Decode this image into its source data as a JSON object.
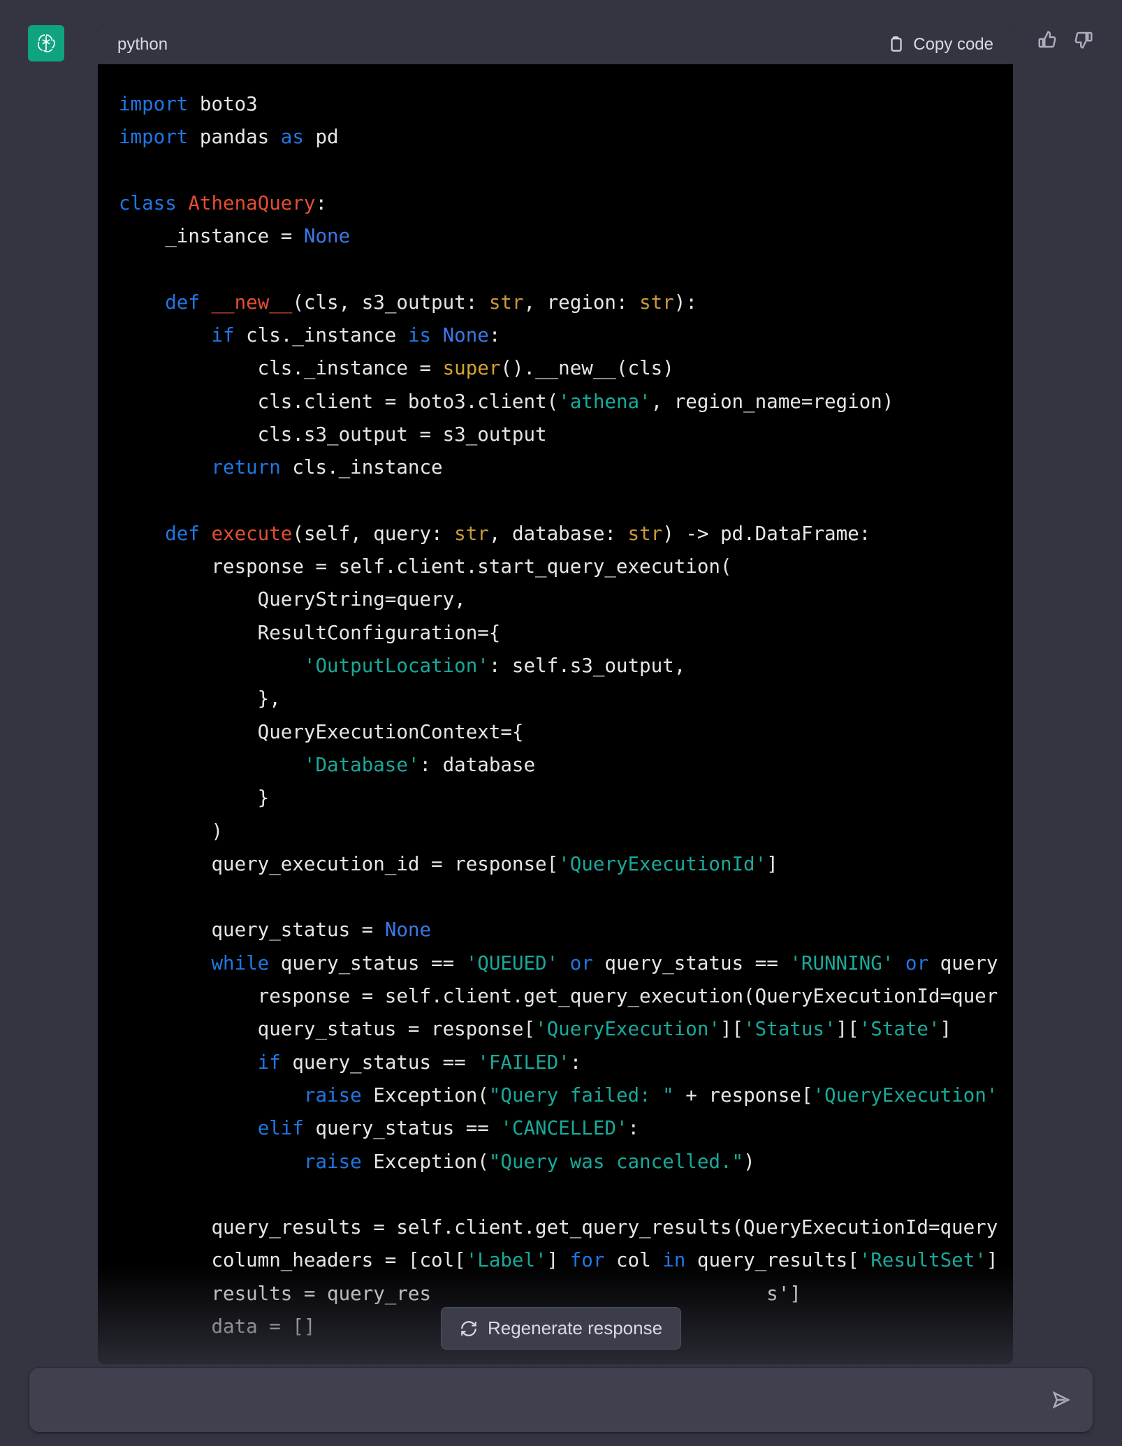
{
  "header": {
    "language_label": "python",
    "copy_label": "Copy code"
  },
  "feedback": {
    "thumbs_up": "thumbs-up",
    "thumbs_down": "thumbs-down"
  },
  "regenerate_label": "Regenerate response",
  "input": {
    "placeholder": ""
  },
  "code": {
    "language": "python",
    "tokens": [
      [
        [
          "kw",
          "import"
        ],
        [
          "id",
          " boto3"
        ]
      ],
      [
        [
          "kw",
          "import"
        ],
        [
          "id",
          " pandas "
        ],
        [
          "kw",
          "as"
        ],
        [
          "id",
          " pd"
        ]
      ],
      [],
      [
        [
          "kw",
          "class"
        ],
        [
          "id",
          " "
        ],
        [
          "cls",
          "AthenaQuery"
        ],
        [
          "op",
          ":"
        ]
      ],
      [
        [
          "id",
          "    _instance = "
        ],
        [
          "nn",
          "None"
        ]
      ],
      [],
      [
        [
          "id",
          "    "
        ],
        [
          "kw",
          "def"
        ],
        [
          "id",
          " "
        ],
        [
          "cls",
          "__new__"
        ],
        [
          "op",
          "("
        ],
        [
          "id",
          "cls, s3_output: "
        ],
        [
          "typ",
          "str"
        ],
        [
          "id",
          ", region: "
        ],
        [
          "typ",
          "str"
        ],
        [
          "op",
          "):"
        ]
      ],
      [
        [
          "id",
          "        "
        ],
        [
          "kw",
          "if"
        ],
        [
          "id",
          " cls._instance "
        ],
        [
          "kw",
          "is"
        ],
        [
          "id",
          " "
        ],
        [
          "nn",
          "None"
        ],
        [
          "op",
          ":"
        ]
      ],
      [
        [
          "id",
          "            cls._instance = "
        ],
        [
          "bn",
          "super"
        ],
        [
          "op",
          "()"
        ],
        [
          "id",
          ".__new__(cls)"
        ]
      ],
      [
        [
          "id",
          "            cls.client = boto3.client("
        ],
        [
          "str",
          "'athena'"
        ],
        [
          "id",
          ", region_name=region)"
        ]
      ],
      [
        [
          "id",
          "            cls.s3_output = s3_output"
        ]
      ],
      [
        [
          "id",
          "        "
        ],
        [
          "kw",
          "return"
        ],
        [
          "id",
          " cls._instance"
        ]
      ],
      [],
      [
        [
          "id",
          "    "
        ],
        [
          "kw",
          "def"
        ],
        [
          "id",
          " "
        ],
        [
          "cls",
          "execute"
        ],
        [
          "op",
          "("
        ],
        [
          "id",
          "self, query: "
        ],
        [
          "typ",
          "str"
        ],
        [
          "id",
          ", database: "
        ],
        [
          "typ",
          "str"
        ],
        [
          "op",
          ") -> "
        ],
        [
          "id",
          "pd.DataFrame:"
        ]
      ],
      [
        [
          "id",
          "        response = self.client.start_query_execution("
        ]
      ],
      [
        [
          "id",
          "            QueryString=query,"
        ]
      ],
      [
        [
          "id",
          "            ResultConfiguration={"
        ]
      ],
      [
        [
          "id",
          "                "
        ],
        [
          "str",
          "'OutputLocation'"
        ],
        [
          "id",
          ": self.s3_output,"
        ]
      ],
      [
        [
          "id",
          "            },"
        ]
      ],
      [
        [
          "id",
          "            QueryExecutionContext={"
        ]
      ],
      [
        [
          "id",
          "                "
        ],
        [
          "str",
          "'Database'"
        ],
        [
          "id",
          ": database"
        ]
      ],
      [
        [
          "id",
          "            }"
        ]
      ],
      [
        [
          "id",
          "        )"
        ]
      ],
      [
        [
          "id",
          "        query_execution_id = response["
        ],
        [
          "str",
          "'QueryExecutionId'"
        ],
        [
          "id",
          "]"
        ]
      ],
      [],
      [
        [
          "id",
          "        query_status = "
        ],
        [
          "nn",
          "None"
        ]
      ],
      [
        [
          "id",
          "        "
        ],
        [
          "kw",
          "while"
        ],
        [
          "id",
          " query_status == "
        ],
        [
          "str",
          "'QUEUED'"
        ],
        [
          "id",
          " "
        ],
        [
          "kw",
          "or"
        ],
        [
          "id",
          " query_status == "
        ],
        [
          "str",
          "'RUNNING'"
        ],
        [
          "id",
          " "
        ],
        [
          "kw",
          "or"
        ],
        [
          "id",
          " query"
        ]
      ],
      [
        [
          "id",
          "            response = self.client.get_query_execution(QueryExecutionId=quer"
        ]
      ],
      [
        [
          "id",
          "            query_status = response["
        ],
        [
          "str",
          "'QueryExecution'"
        ],
        [
          "id",
          "]["
        ],
        [
          "str",
          "'Status'"
        ],
        [
          "id",
          "]["
        ],
        [
          "str",
          "'State'"
        ],
        [
          "id",
          "]"
        ]
      ],
      [
        [
          "id",
          "            "
        ],
        [
          "kw",
          "if"
        ],
        [
          "id",
          " query_status == "
        ],
        [
          "str",
          "'FAILED'"
        ],
        [
          "op",
          ":"
        ]
      ],
      [
        [
          "id",
          "                "
        ],
        [
          "kw",
          "raise"
        ],
        [
          "id",
          " Exception("
        ],
        [
          "str",
          "\"Query failed: \""
        ],
        [
          "id",
          " + response["
        ],
        [
          "str",
          "'QueryExecution'"
        ]
      ],
      [
        [
          "id",
          "            "
        ],
        [
          "kw",
          "elif"
        ],
        [
          "id",
          " query_status == "
        ],
        [
          "str",
          "'CANCELLED'"
        ],
        [
          "op",
          ":"
        ]
      ],
      [
        [
          "id",
          "                "
        ],
        [
          "kw",
          "raise"
        ],
        [
          "id",
          " Exception("
        ],
        [
          "str",
          "\"Query was cancelled.\""
        ],
        [
          "id",
          ")"
        ]
      ],
      [],
      [
        [
          "id",
          "        query_results = self.client.get_query_results(QueryExecutionId=query"
        ]
      ],
      [
        [
          "id",
          "        column_headers = [col["
        ],
        [
          "str",
          "'Label'"
        ],
        [
          "id",
          "] "
        ],
        [
          "kw",
          "for"
        ],
        [
          "id",
          " col "
        ],
        [
          "kw",
          "in"
        ],
        [
          "id",
          " query_results["
        ],
        [
          "str",
          "'ResultSet'"
        ],
        [
          "id",
          "]"
        ]
      ],
      [
        [
          "id",
          "        results = query_res                             s'"
        ],
        [
          "id",
          "]"
        ]
      ],
      [
        [
          "id",
          "        data = []"
        ]
      ]
    ]
  }
}
